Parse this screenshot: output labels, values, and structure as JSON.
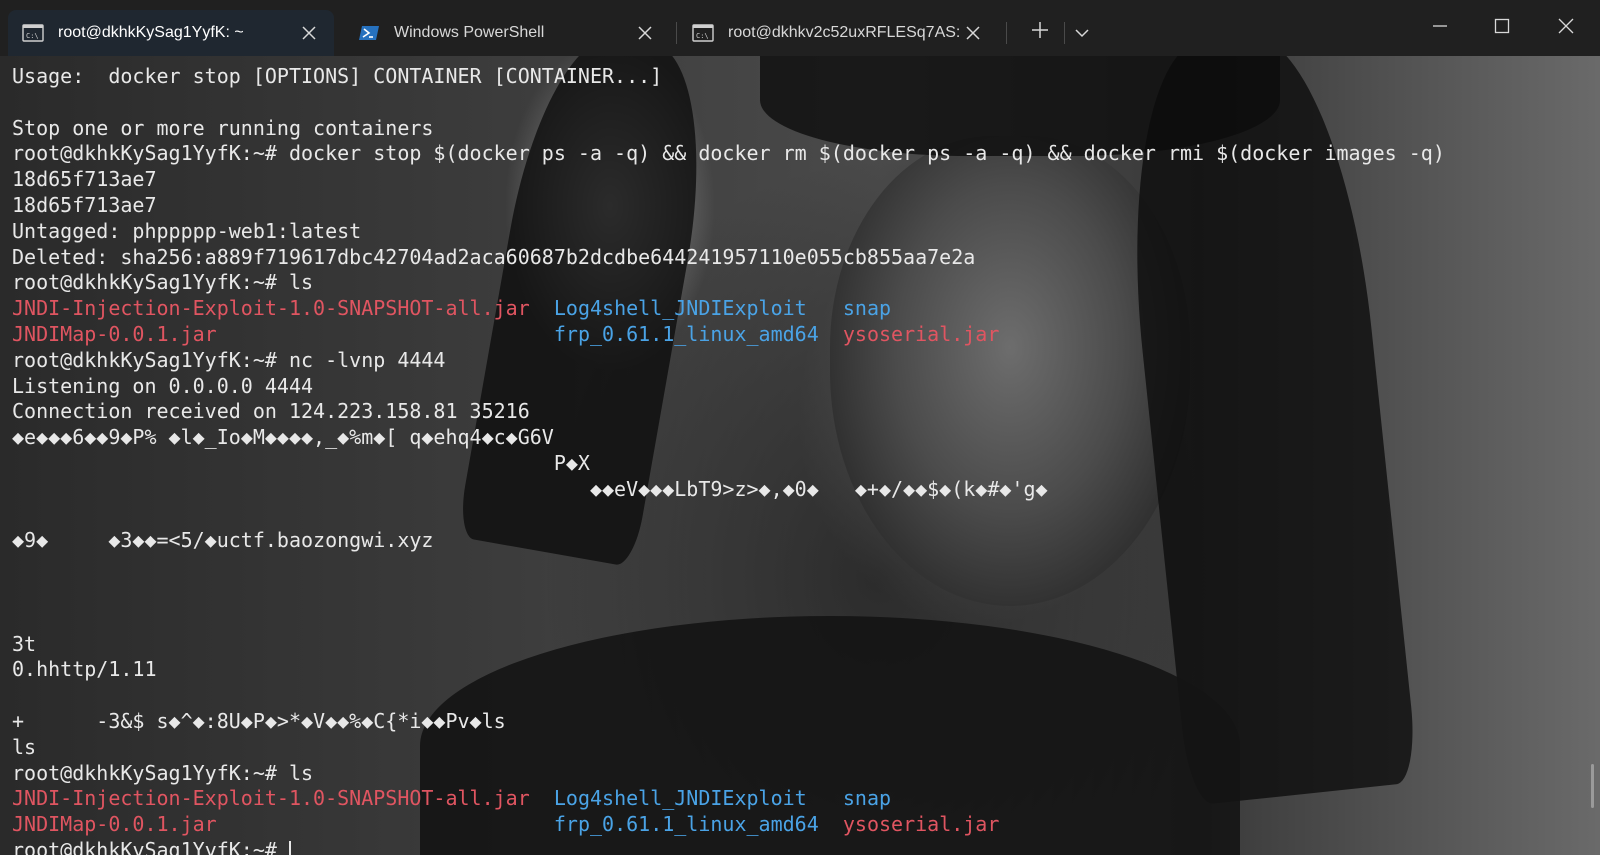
{
  "window": {
    "tabs": [
      {
        "label": "root@dkhkKySag1YyfK: ~",
        "icon": "cmd-icon",
        "active": true
      },
      {
        "label": "Windows PowerShell",
        "icon": "powershell-icon",
        "active": false
      },
      {
        "label": "root@dkhkv2c52uxRFLESq7AS:",
        "icon": "cmd-icon",
        "active": false
      }
    ],
    "new_tab_icon": "plus-icon",
    "dropdown_icon": "chevron-down-icon",
    "controls": [
      "minimize-icon",
      "maximize-icon",
      "close-icon"
    ]
  },
  "colors": {
    "accent_red": "#e05561",
    "accent_blue": "#4aa3e6",
    "text": "#e8e8e8"
  },
  "terminal": {
    "lines": [
      {
        "text": "Usage:  docker stop [OPTIONS] CONTAINER [CONTAINER...]"
      },
      {
        "text": ""
      },
      {
        "text": "Stop one or more running containers"
      },
      {
        "text": "root@dkhkKySag1YyfK:~# docker stop $(docker ps -a -q) && docker rm $(docker ps -a -q) && docker rmi $(docker images -q)"
      },
      {
        "text": "18d65f713ae7"
      },
      {
        "text": "18d65f713ae7"
      },
      {
        "text": "Untagged: phppppp-web1:latest"
      },
      {
        "text": "Deleted: sha256:a889f719617dbc42704ad2aca60687b2dcdbe644241957110e055cb855aa7e2a"
      },
      {
        "text": "root@dkhkKySag1YyfK:~# ls"
      },
      {
        "segments": [
          {
            "t": "JNDI-Injection-Exploit-1.0-SNAPSHOT-all.jar",
            "c": "red"
          },
          {
            "t": "  "
          },
          {
            "t": "Log4shell_JNDIExploit",
            "c": "blue"
          },
          {
            "t": "   "
          },
          {
            "t": "snap",
            "c": "blue"
          }
        ]
      },
      {
        "segments": [
          {
            "t": "JNDIMap-0.0.1.jar",
            "c": "red"
          },
          {
            "t": "                            "
          },
          {
            "t": "frp_0.61.1_linux_amd64",
            "c": "blue"
          },
          {
            "t": "  "
          },
          {
            "t": "ysoserial.jar",
            "c": "red"
          }
        ]
      },
      {
        "text": "root@dkhkKySag1YyfK:~# nc -lvnp 4444"
      },
      {
        "text": "Listening on 0.0.0.0 4444"
      },
      {
        "text": "Connection received on 124.223.158.81 35216"
      },
      {
        "text": "◆e◆◆◆6◆◆9◆P% ◆l◆_Io◆M◆◆◆◆,_◆%m◆[ q◆ehq4◆c◆G6V"
      },
      {
        "text": "                                             P◆X"
      },
      {
        "text": "                                                ◆◆eV◆◆◆LbT9>z>◆,◆0◆   ◆+◆/◆◆$◆(k◆#◆'g◆"
      },
      {
        "text": ""
      },
      {
        "text": "◆9◆     ◆3◆◆=<5/◆uctf.baozongwi.xyz"
      },
      {
        "text": ""
      },
      {
        "text": ""
      },
      {
        "text": ""
      },
      {
        "text": "3t"
      },
      {
        "text": "0.hhttp/1.11"
      },
      {
        "text": ""
      },
      {
        "text": "+      -3&$ s◆^◆:8U◆P◆>*◆V◆◆%◆C{*i◆◆Pv◆ls"
      },
      {
        "text": "ls"
      },
      {
        "text": "root@dkhkKySag1YyfK:~# ls"
      },
      {
        "segments": [
          {
            "t": "JNDI-Injection-Exploit-1.0-SNAPSHOT-all.jar",
            "c": "red"
          },
          {
            "t": "  "
          },
          {
            "t": "Log4shell_JNDIExploit",
            "c": "blue"
          },
          {
            "t": "   "
          },
          {
            "t": "snap",
            "c": "blue"
          }
        ]
      },
      {
        "segments": [
          {
            "t": "JNDIMap-0.0.1.jar",
            "c": "red"
          },
          {
            "t": "                            "
          },
          {
            "t": "frp_0.61.1_linux_amd64",
            "c": "blue"
          },
          {
            "t": "  "
          },
          {
            "t": "ysoserial.jar",
            "c": "red"
          }
        ]
      },
      {
        "text": "root@dkhkKySag1YyfK:~# ",
        "cursor": true
      }
    ]
  }
}
